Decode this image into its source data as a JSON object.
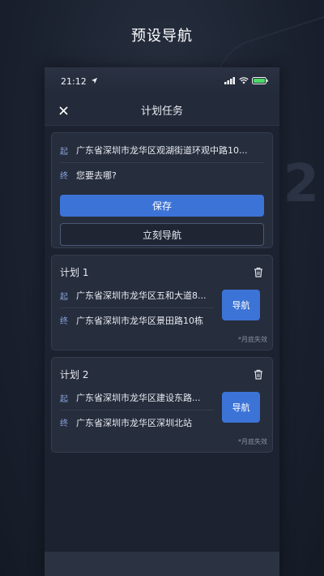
{
  "promo": {
    "title": "预设导航"
  },
  "status_bar": {
    "time": "21:12"
  },
  "header": {
    "title": "计划任务",
    "close_icon": "close-icon"
  },
  "route_editor": {
    "start_tag": "起",
    "start_value": "广东省深圳市龙华区观湖街道环观中路10...",
    "end_tag": "终",
    "end_placeholder": "您要去哪?",
    "save_label": "保存",
    "navigate_now_label": "立刻导航"
  },
  "plans": [
    {
      "title": "计划 1",
      "start_tag": "起",
      "start": "广东省深圳市龙华区五和大道8...",
      "end_tag": "终",
      "end": "广东省深圳市龙华区景田路10栋",
      "nav_label": "导航",
      "expire": "*月底失效"
    },
    {
      "title": "计划 2",
      "start_tag": "起",
      "start": "广东省深圳市龙华区建设东路...",
      "end_tag": "终",
      "end": "广东省深圳市龙华区深圳北站",
      "nav_label": "导航",
      "expire": "*月底失效"
    }
  ],
  "colors": {
    "accent": "#3c73d6",
    "background": "#1c2230",
    "card": "#262d3c"
  }
}
